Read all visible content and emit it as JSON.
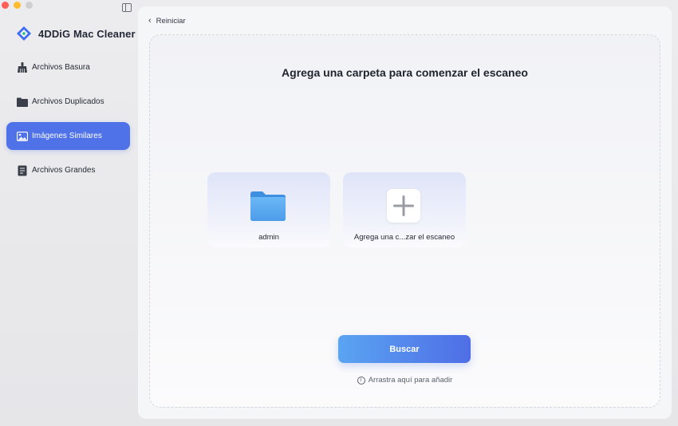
{
  "app": {
    "name": "4DDiG Mac Cleaner"
  },
  "sidebar": {
    "items": [
      {
        "label": "Archivos Basura",
        "icon": "broom-icon"
      },
      {
        "label": "Archivos Duplicados",
        "icon": "folder-icon"
      },
      {
        "label": "Imágenes Similares",
        "icon": "image-icon",
        "active": true
      },
      {
        "label": "Archivos Grandes",
        "icon": "document-icon"
      }
    ]
  },
  "main": {
    "back_label": "Reiniciar",
    "title": "Agrega una carpeta para comenzar el escaneo",
    "cards": [
      {
        "label": "admin",
        "icon": "folder-icon"
      },
      {
        "label": "Agrega una c...zar el escaneo",
        "icon": "plus-icon"
      }
    ],
    "search_button": "Buscar",
    "hint": "Arrastra aquí para añadir",
    "hint_icon": "ⓘ"
  },
  "colors": {
    "accent": "#4f72e8",
    "button_gradient_start": "#5aa4f2",
    "button_gradient_end": "#4f6ee6",
    "folder_blue": "#5aa9f0"
  }
}
